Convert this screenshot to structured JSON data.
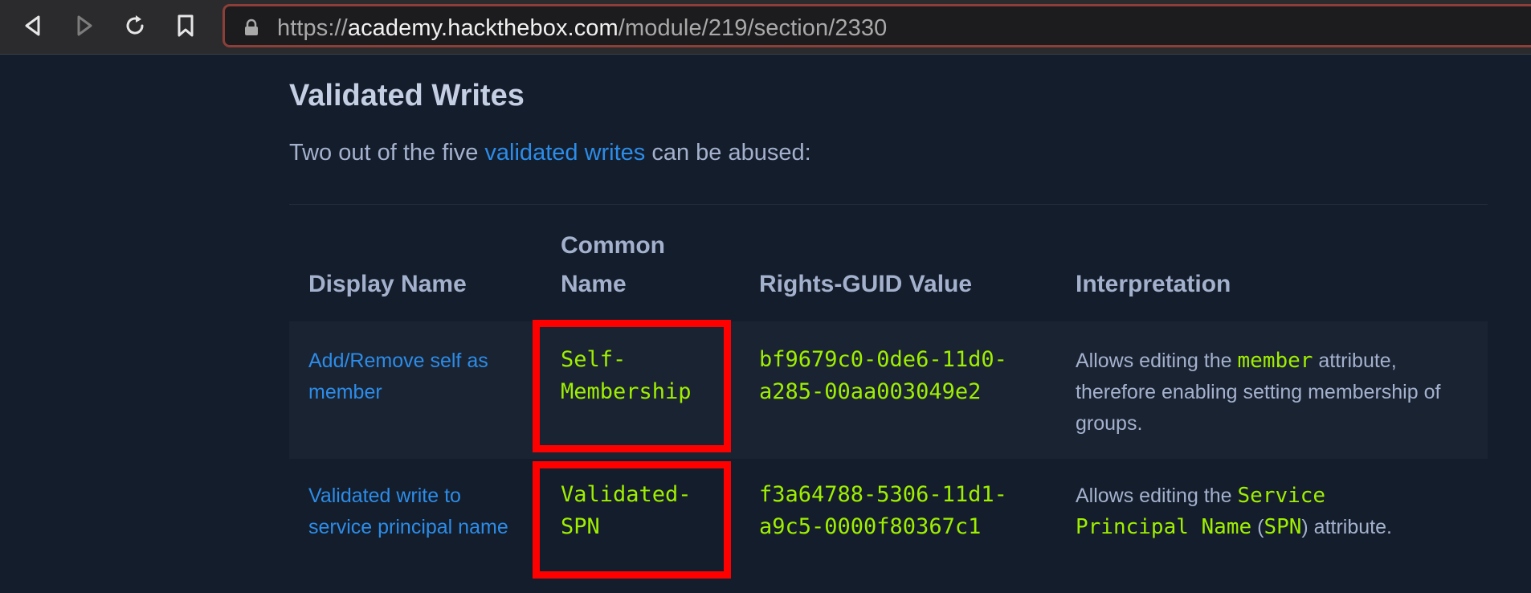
{
  "browser": {
    "back_icon": "back-arrow-icon",
    "forward_icon": "forward-arrow-icon",
    "reload_icon": "reload-icon",
    "bookmark_icon": "bookmark-icon",
    "lock_icon": "lock-icon",
    "url_protocol": "https://",
    "url_host": "academy.hackthebox.com",
    "url_path": "/module/219/section/2330",
    "url_border_color": "#8c3f38"
  },
  "content": {
    "title": "Validated Writes",
    "intro_before": "Two out of the five ",
    "intro_link": "validated writes",
    "intro_after": " can be abused:",
    "link_color": "#2c8ce8",
    "code_color": "#9fef00"
  },
  "table": {
    "headers": {
      "display_name": "Display Name",
      "common_name_1": "Common",
      "common_name_2": "Name",
      "guid": "Rights-GUID Value",
      "interpretation": "Interpretation"
    },
    "rows": [
      {
        "display_name_1": "Add/Remove self as",
        "display_name_2": "member",
        "common_name_1": "Self-",
        "common_name_2": "Membership",
        "guid_1": "bf9679c0-0de6-11d0-",
        "guid_2": "a285-00aa003049e2",
        "interp_pre": "Allows editing the ",
        "interp_code": "member",
        "interp_post": " attribute,",
        "interp_line2": "therefore enabling setting membership of",
        "interp_line3": "groups."
      },
      {
        "display_name_1": "Validated write to",
        "display_name_2": "service principal name",
        "common_name_1": "Validated-",
        "common_name_2": "SPN",
        "guid_1": "f3a64788-5306-11d1-",
        "guid_2": "a9c5-0000f80367c1",
        "interp_pre": "Allows editing the ",
        "interp_code1": "Service",
        "interp_code2": "Principal Name",
        "interp_paren_open": " (",
        "interp_code3": "SPN",
        "interp_post": ") attribute."
      }
    ],
    "highlight_color": "#ff0000"
  }
}
